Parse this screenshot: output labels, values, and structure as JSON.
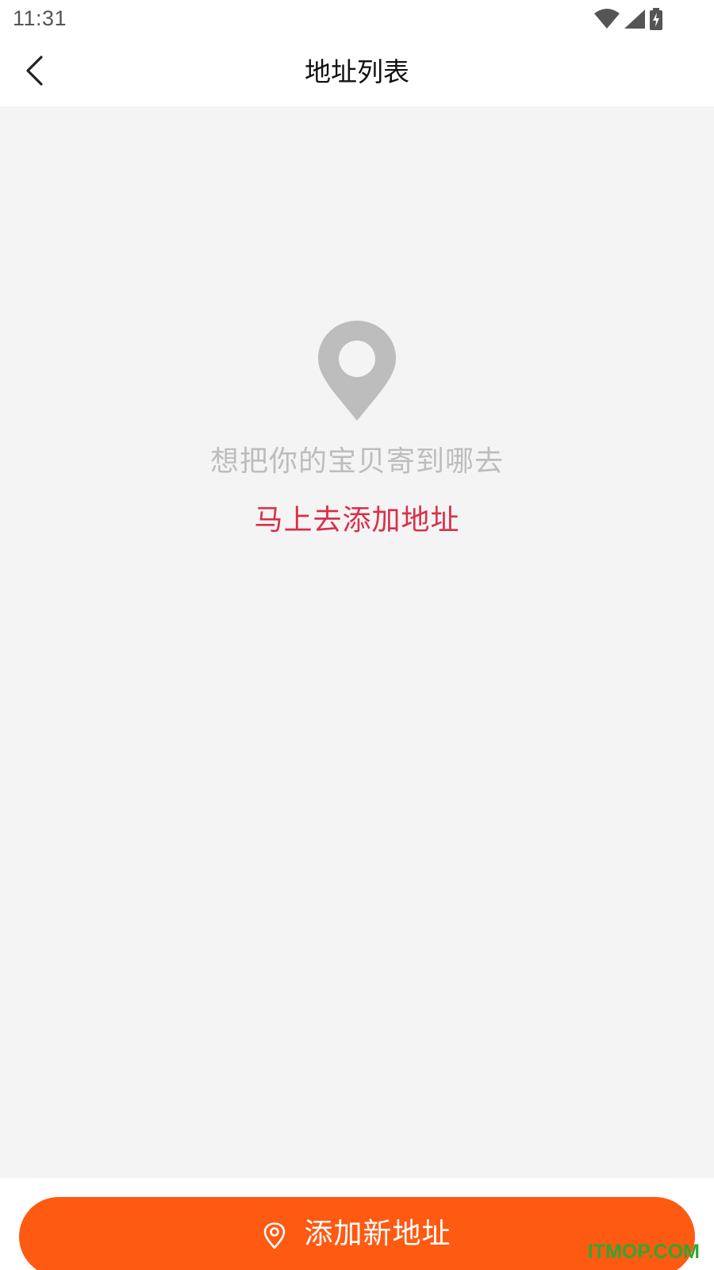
{
  "status_bar": {
    "time": "11:31",
    "icons": [
      "wifi-icon",
      "signal-icon",
      "battery-charging-icon"
    ]
  },
  "header": {
    "back_icon": "chevron-left-icon",
    "title": "地址列表"
  },
  "empty_state": {
    "icon": "location-pin-icon",
    "message": "想把你的宝贝寄到哪去",
    "action_label": "马上去添加地址"
  },
  "bottom": {
    "button_icon": "location-outline-icon",
    "button_label": "添加新地址"
  },
  "watermark": "ITMOP.COM",
  "colors": {
    "accent_orange": "#fe5a12",
    "link_red": "#d8304a",
    "muted_text": "#bdbdbd",
    "pin_gray": "#bdbdbd",
    "content_bg": "#f4f4f4"
  }
}
